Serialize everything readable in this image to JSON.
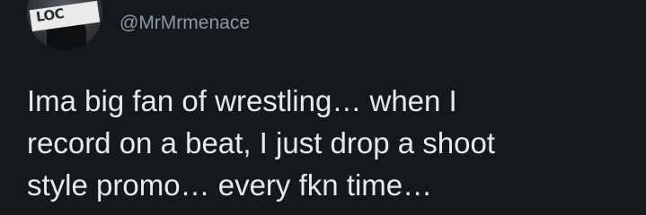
{
  "user": {
    "handle": "@MrMrmenace",
    "avatar_icon": "profile-photo",
    "avatar_text": "LOC"
  },
  "tweet": {
    "lines": [
      "Ima big fan of wrestling… when I",
      "record on a beat, I just drop a shoot",
      "style promo… every fkn time…"
    ]
  },
  "colors": {
    "background": "#15181c",
    "text": "#e7e9ea",
    "secondary_text": "#8b98a5"
  }
}
